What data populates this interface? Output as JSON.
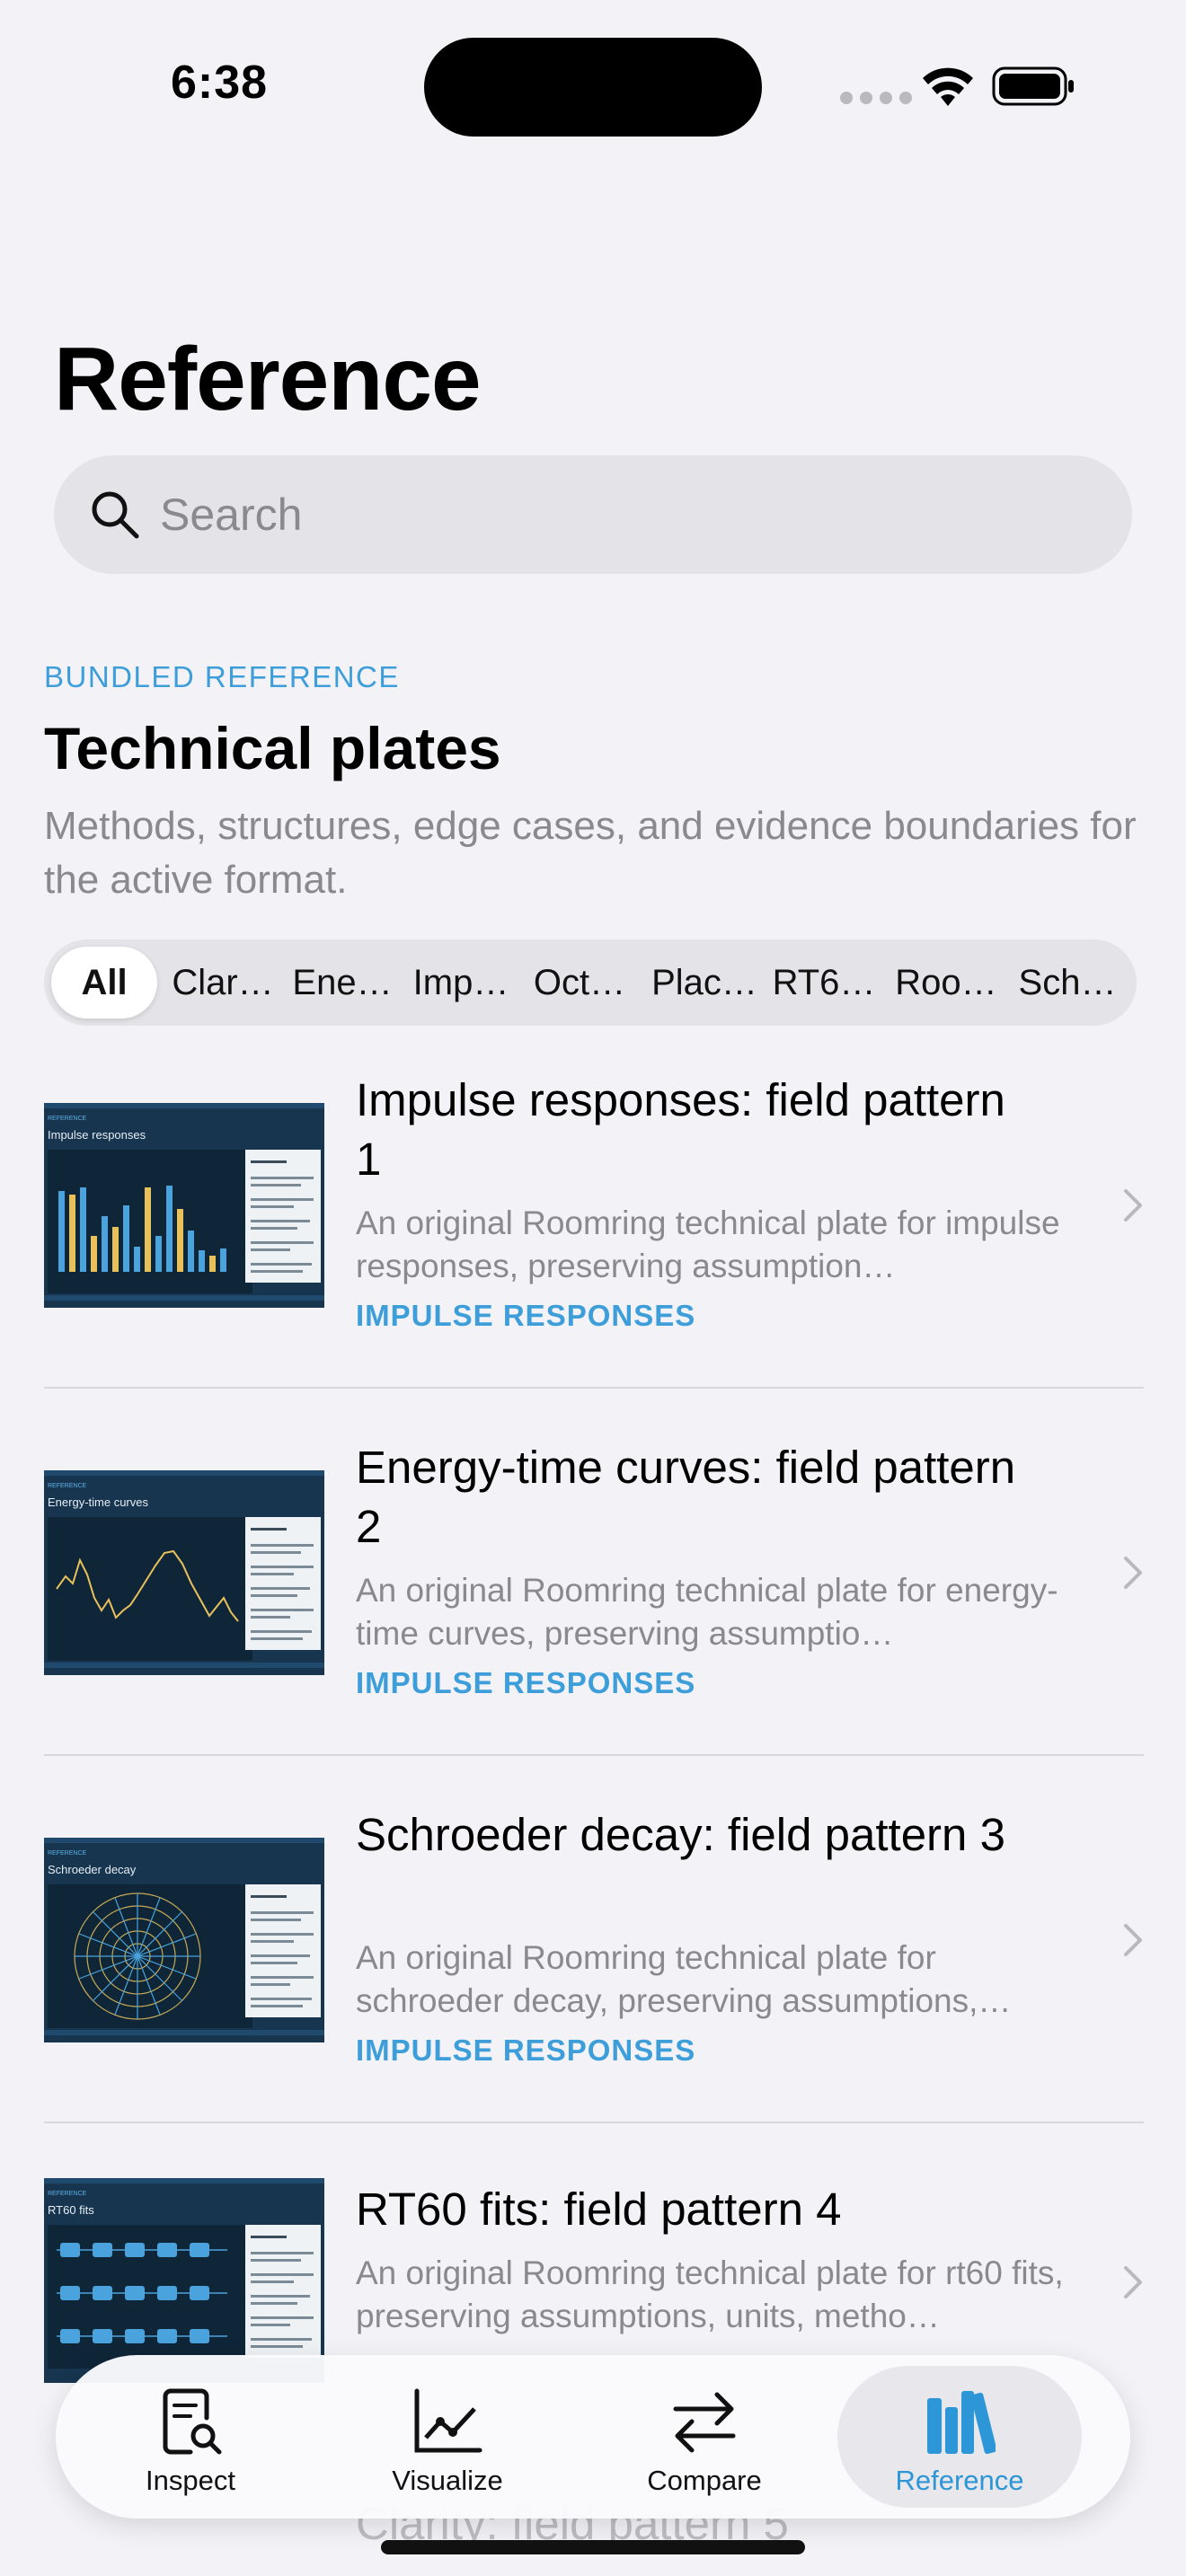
{
  "status": {
    "time": "6:38"
  },
  "page": {
    "title": "Reference"
  },
  "search": {
    "placeholder": "Search"
  },
  "section": {
    "eyebrow": "BUNDLED REFERENCE",
    "title": "Technical plates",
    "description": "Methods, structures, edge cases, and evidence boundaries for the active format."
  },
  "filters": [
    {
      "label": "All",
      "selected": true
    },
    {
      "label": "Clar…"
    },
    {
      "label": "Ene…"
    },
    {
      "label": "Imp…"
    },
    {
      "label": "Oct…"
    },
    {
      "label": "Plac…"
    },
    {
      "label": "RT6…"
    },
    {
      "label": "Roo…"
    },
    {
      "label": "Sch…"
    }
  ],
  "items": [
    {
      "title": "Impulse responses: field pattern 1",
      "description": "An original Roomring technical plate for impulse responses, preserving assumption…",
      "tag": "IMPULSE RESPONSES",
      "thumb_label": "Impulse responses",
      "thumb_kind": "bars"
    },
    {
      "title": "Energy-time curves: field pattern 2",
      "description": "An original Roomring technical plate for energy-time curves, preserving assumptio…",
      "tag": "IMPULSE RESPONSES",
      "thumb_label": "Energy-time curves",
      "thumb_kind": "line"
    },
    {
      "title": "Schroeder decay: field pattern 3",
      "description": "An original Roomring technical plate for schroeder decay, preserving assumptions,…",
      "tag": "IMPULSE RESPONSES",
      "thumb_label": "Schroeder decay",
      "thumb_kind": "polar"
    },
    {
      "title": "RT60 fits: field pattern 4",
      "description": "An original Roomring technical plate for rt60 fits, preserving assumptions, units, metho…",
      "tag": "",
      "thumb_label": "RT60 fits",
      "thumb_kind": "nodes"
    }
  ],
  "peek_item": {
    "title": "Clarity: field pattern 5"
  },
  "tabs": [
    {
      "label": "Inspect",
      "icon": "doc-magnify-icon"
    },
    {
      "label": "Visualize",
      "icon": "chart-line-icon"
    },
    {
      "label": "Compare",
      "icon": "arrows-swap-icon"
    },
    {
      "label": "Reference",
      "icon": "books-icon",
      "selected": true
    }
  ],
  "colors": {
    "accent": "#3d9ed9",
    "background": "#f2f2f7",
    "thumb_bg": "#17354f",
    "thumb_bar_blue": "#4aa3dc",
    "thumb_bar_yellow": "#e8c15a"
  }
}
